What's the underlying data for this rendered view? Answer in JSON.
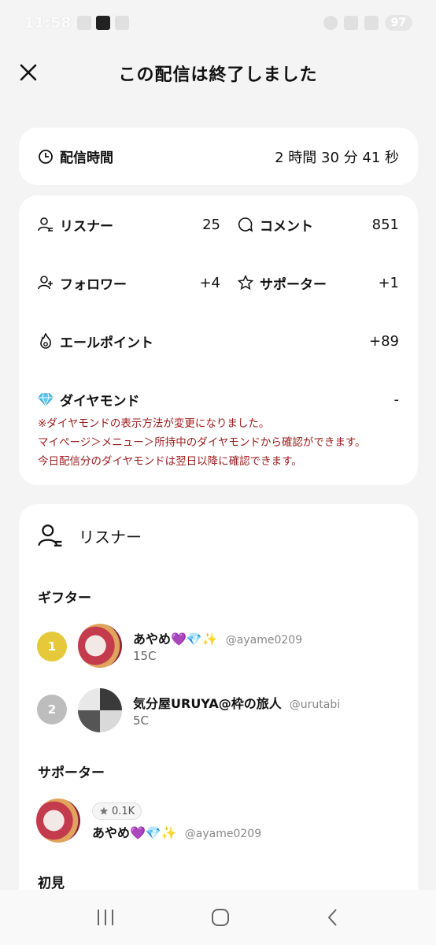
{
  "status_bar": {
    "time": "11:58",
    "battery": "97"
  },
  "header": {
    "title": "この配信は終了しました"
  },
  "broadcast_time": {
    "label": "配信時間",
    "value": "2 時間 30 分 41 秒"
  },
  "stats": {
    "listeners": {
      "label": "リスナー",
      "value": "25"
    },
    "comments": {
      "label": "コメント",
      "value": "851"
    },
    "followers": {
      "label": "フォロワー",
      "value": "+4"
    },
    "supporters": {
      "label": "サポーター",
      "value": "+1"
    },
    "yell_points": {
      "label": "エールポイント",
      "value": "+89"
    },
    "diamonds": {
      "label": "ダイヤモンド",
      "value": "-"
    },
    "notice": [
      "※ダイヤモンドの表示方法が変更になりました。",
      "マイページ＞メニュー＞所持中のダイヤモンドから確認ができます。",
      "今日配信分のダイヤモンドは翌日以降に確認できます。"
    ]
  },
  "listeners_section": {
    "title": "リスナー",
    "gifters_label": "ギフター",
    "gifters": [
      {
        "rank": "1",
        "name": "あやめ💜💎✨",
        "handle": "@ayame0209",
        "coins": "15C"
      },
      {
        "rank": "2",
        "name": "気分屋URUYA@枠の旅人",
        "handle": "@urutabi",
        "coins": "5C"
      }
    ],
    "supporters_label": "サポーター",
    "supporters": [
      {
        "badge": "0.1K",
        "name": "あやめ💜💎✨",
        "handle": "@ayame0209"
      }
    ],
    "first_time_label": "初見"
  },
  "colors": {
    "rank1": "#e6c93a",
    "rank2": "#bdbdbd",
    "notice": "#9b1b1b"
  }
}
